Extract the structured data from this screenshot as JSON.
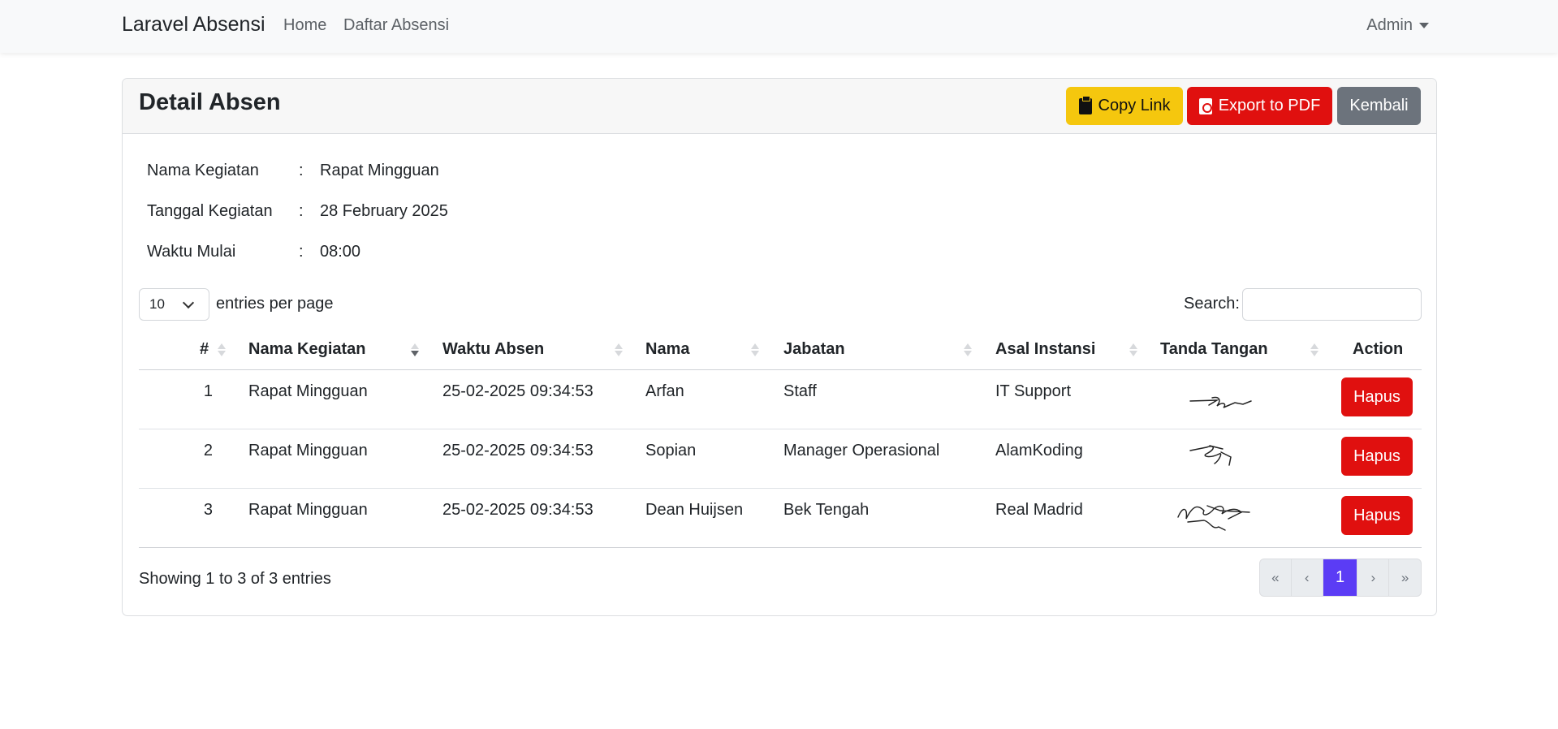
{
  "navbar": {
    "brand": "Laravel Absensi",
    "links": [
      "Home",
      "Daftar Absensi"
    ],
    "user": "Admin"
  },
  "card": {
    "title": "Detail Absen",
    "buttons": {
      "copy": "Copy Link",
      "pdf": "Export to PDF",
      "back": "Kembali"
    }
  },
  "info": [
    {
      "label": "Nama Kegiatan",
      "value": "Rapat Mingguan"
    },
    {
      "label": "Tanggal Kegiatan",
      "value": "28 February 2025"
    },
    {
      "label": "Waktu Mulai",
      "value": "08:00"
    }
  ],
  "table": {
    "page_length": "10",
    "page_length_text": "entries per page",
    "search_label": "Search:",
    "search_value": "",
    "columns": [
      "#",
      "Nama Kegiatan",
      "Waktu Absen",
      "Nama",
      "Jabatan",
      "Asal Instansi",
      "Tanda Tangan",
      "Action"
    ],
    "sorted_column": "Nama Kegiatan",
    "rows": [
      {
        "no": "1",
        "kegiatan": "Rapat Mingguan",
        "waktu": "25-02-2025 09:34:53",
        "nama": "Arfan",
        "jabatan": "Staff",
        "instansi": "IT Support",
        "action": "Hapus"
      },
      {
        "no": "2",
        "kegiatan": "Rapat Mingguan",
        "waktu": "25-02-2025 09:34:53",
        "nama": "Sopian",
        "jabatan": "Manager Operasional",
        "instansi": "AlamKoding",
        "action": "Hapus"
      },
      {
        "no": "3",
        "kegiatan": "Rapat Mingguan",
        "waktu": "25-02-2025 09:34:53",
        "nama": "Dean Huijsen",
        "jabatan": "Bek Tengah",
        "instansi": "Real Madrid",
        "action": "Hapus"
      }
    ],
    "footer_info": "Showing 1 to 3 of 3 entries",
    "pagination": [
      "«",
      "‹",
      "1",
      "›",
      "»"
    ],
    "current_page": "1"
  },
  "colors": {
    "copy_button": "#f5c70e",
    "danger": "#e0100f",
    "secondary": "#6c737c",
    "page_active": "#5b3cf5"
  }
}
